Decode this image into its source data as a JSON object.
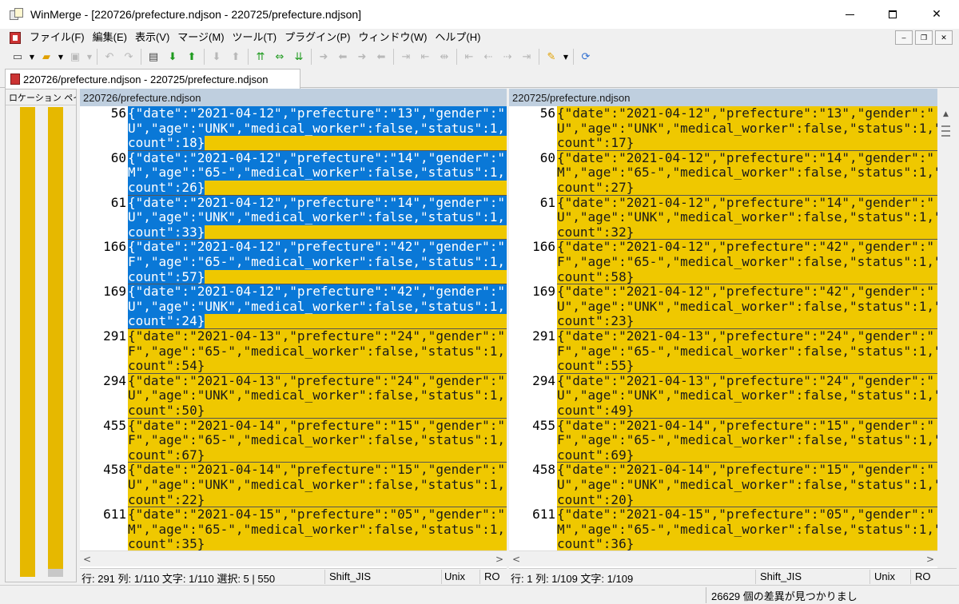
{
  "window": {
    "title": "WinMerge - [220726/prefecture.ndjson - 220725/prefecture.ndjson]",
    "minimize": "—",
    "maximize": "☐",
    "close": "✕"
  },
  "menu": {
    "items": [
      "ファイル(F)",
      "編集(E)",
      "表示(V)",
      "マージ(M)",
      "ツール(T)",
      "プラグイン(P)",
      "ウィンドウ(W)",
      "ヘルプ(H)"
    ],
    "mdi_minimize": "–",
    "mdi_restore": "❐",
    "mdi_close": "✕"
  },
  "tab": {
    "label": "220726/prefecture.ndjson - 220725/prefecture.ndjson"
  },
  "location_pane": {
    "title": "ロケーション ペイン",
    "close": "✕"
  },
  "left_pane": {
    "header": "220726/prefecture.ndjson",
    "rows": [
      {
        "num": "56",
        "l1": "{\"date\":\"2021-04-12\",\"prefecture\":\"13\",\"gender\":\"",
        "l2": "U\",\"age\":\"UNK\",\"medical_worker\":false,\"status\":1,\"",
        "l3": "count\":18}",
        "selected": true
      },
      {
        "num": "60",
        "l1": "{\"date\":\"2021-04-12\",\"prefecture\":\"14\",\"gender\":\"",
        "l2": "M\",\"age\":\"65-\",\"medical_worker\":false,\"status\":1,\"",
        "l3": "count\":26}",
        "selected": true
      },
      {
        "num": "61",
        "l1": "{\"date\":\"2021-04-12\",\"prefecture\":\"14\",\"gender\":\"",
        "l2": "U\",\"age\":\"UNK\",\"medical_worker\":false,\"status\":1,\"",
        "l3": "count\":33}",
        "selected": true
      },
      {
        "num": "166",
        "l1": "{\"date\":\"2021-04-12\",\"prefecture\":\"42\",\"gender\":\"",
        "l2": "F\",\"age\":\"65-\",\"medical_worker\":false,\"status\":1,\"",
        "l3": "count\":57}",
        "selected": true
      },
      {
        "num": "169",
        "l1": "{\"date\":\"2021-04-12\",\"prefecture\":\"42\",\"gender\":\"",
        "l2": "U\",\"age\":\"UNK\",\"medical_worker\":false,\"status\":1,\"",
        "l3": "count\":24}",
        "selected": true
      },
      {
        "num": "291",
        "l1": "{\"date\":\"2021-04-13\",\"prefecture\":\"24\",\"gender\":\"",
        "l2": "F\",\"age\":\"65-\",\"medical_worker\":false,\"status\":1,\"",
        "l3": "count\":54}",
        "selected": false
      },
      {
        "num": "294",
        "l1": "{\"date\":\"2021-04-13\",\"prefecture\":\"24\",\"gender\":\"",
        "l2": "U\",\"age\":\"UNK\",\"medical_worker\":false,\"status\":1,\"",
        "l3": "count\":50}",
        "selected": false
      },
      {
        "num": "455",
        "l1": "{\"date\":\"2021-04-14\",\"prefecture\":\"15\",\"gender\":\"",
        "l2": "F\",\"age\":\"65-\",\"medical_worker\":false,\"status\":1,\"",
        "l3": "count\":67}",
        "selected": false
      },
      {
        "num": "458",
        "l1": "{\"date\":\"2021-04-14\",\"prefecture\":\"15\",\"gender\":\"",
        "l2": "U\",\"age\":\"UNK\",\"medical_worker\":false,\"status\":1,\"",
        "l3": "count\":22}",
        "selected": false
      },
      {
        "num": "611",
        "l1": "{\"date\":\"2021-04-15\",\"prefecture\":\"05\",\"gender\":\"",
        "l2": "M\",\"age\":\"65-\",\"medical_worker\":false,\"status\":1,\"",
        "l3": "count\":35}",
        "selected": false
      }
    ],
    "status": {
      "pos": "行: 291  列: 1/110  文字: 1/110  選択: 5 | 550",
      "encoding": "Shift_JIS",
      "eol": "Unix",
      "mode": "RO"
    }
  },
  "right_pane": {
    "header": "220725/prefecture.ndjson",
    "rows": [
      {
        "num": "56",
        "l1": "{\"date\":\"2021-04-12\",\"prefecture\":\"13\",\"gender\":\"",
        "l2": "U\",\"age\":\"UNK\",\"medical_worker\":false,\"status\":1,\"",
        "l3": "count\":17}"
      },
      {
        "num": "60",
        "l1": "{\"date\":\"2021-04-12\",\"prefecture\":\"14\",\"gender\":\"",
        "l2": "M\",\"age\":\"65-\",\"medical_worker\":false,\"status\":1,\"",
        "l3": "count\":27}"
      },
      {
        "num": "61",
        "l1": "{\"date\":\"2021-04-12\",\"prefecture\":\"14\",\"gender\":\"",
        "l2": "U\",\"age\":\"UNK\",\"medical_worker\":false,\"status\":1,\"",
        "l3": "count\":32}"
      },
      {
        "num": "166",
        "l1": "{\"date\":\"2021-04-12\",\"prefecture\":\"42\",\"gender\":\"",
        "l2": "F\",\"age\":\"65-\",\"medical_worker\":false,\"status\":1,\"",
        "l3": "count\":58}"
      },
      {
        "num": "169",
        "l1": "{\"date\":\"2021-04-12\",\"prefecture\":\"42\",\"gender\":\"",
        "l2": "U\",\"age\":\"UNK\",\"medical_worker\":false,\"status\":1,\"",
        "l3": "count\":23}"
      },
      {
        "num": "291",
        "l1": "{\"date\":\"2021-04-13\",\"prefecture\":\"24\",\"gender\":\"",
        "l2": "F\",\"age\":\"65-\",\"medical_worker\":false,\"status\":1,\"",
        "l3": "count\":55}"
      },
      {
        "num": "294",
        "l1": "{\"date\":\"2021-04-13\",\"prefecture\":\"24\",\"gender\":\"",
        "l2": "U\",\"age\":\"UNK\",\"medical_worker\":false,\"status\":1,\"",
        "l3": "count\":49}"
      },
      {
        "num": "455",
        "l1": "{\"date\":\"2021-04-14\",\"prefecture\":\"15\",\"gender\":\"",
        "l2": "F\",\"age\":\"65-\",\"medical_worker\":false,\"status\":1,\"",
        "l3": "count\":69}"
      },
      {
        "num": "458",
        "l1": "{\"date\":\"2021-04-14\",\"prefecture\":\"15\",\"gender\":\"",
        "l2": "U\",\"age\":\"UNK\",\"medical_worker\":false,\"status\":1,\"",
        "l3": "count\":20}"
      },
      {
        "num": "611",
        "l1": "{\"date\":\"2021-04-15\",\"prefecture\":\"05\",\"gender\":\"",
        "l2": "M\",\"age\":\"65-\",\"medical_worker\":false,\"status\":1,\"",
        "l3": "count\":36}"
      }
    ],
    "status": {
      "pos": "行: 1  列: 1/109  文字: 1/109",
      "encoding": "Shift_JIS",
      "eol": "Unix",
      "mode": "RO"
    }
  },
  "scroll": {
    "left_arrow": "<",
    "right_arrow": ">",
    "up_arrow": "▲"
  },
  "statusbar": {
    "diff_count": "26629 個の差異が見つかりまし"
  },
  "colors": {
    "diff": "#efc800",
    "selection": "#0a78d7",
    "pane_header": "#bfcfdf",
    "location_bar": "#e6b800"
  },
  "toolbar": {
    "icons": [
      {
        "name": "new-icon",
        "glyph": "▭",
        "cls": "ic-dark"
      },
      {
        "name": "new-dropdown-icon",
        "glyph": "▼",
        "cls": "drop"
      },
      {
        "name": "open-icon",
        "glyph": "▰",
        "cls": "ic-orange"
      },
      {
        "name": "open-dropdown-icon",
        "glyph": "▼",
        "cls": "drop"
      },
      {
        "name": "save-icon",
        "glyph": "▣",
        "cls": "disabled"
      },
      {
        "name": "save-dropdown-icon",
        "glyph": "▼",
        "cls": "drop disabled"
      },
      {
        "name": "sep",
        "glyph": ""
      },
      {
        "name": "undo-icon",
        "glyph": "↶",
        "cls": "disabled"
      },
      {
        "name": "redo-icon",
        "glyph": "↷",
        "cls": "disabled"
      },
      {
        "name": "sep",
        "glyph": ""
      },
      {
        "name": "filmstrip-icon",
        "glyph": "▤",
        "cls": "ic-dark"
      },
      {
        "name": "next-diff-icon",
        "glyph": "⬇",
        "cls": "ic-green"
      },
      {
        "name": "prev-diff-icon",
        "glyph": "⬆",
        "cls": "ic-green"
      },
      {
        "name": "sep",
        "glyph": ""
      },
      {
        "name": "next-conflict-icon",
        "glyph": "⬇",
        "cls": "disabled"
      },
      {
        "name": "prev-conflict-icon",
        "glyph": "⬆",
        "cls": "disabled"
      },
      {
        "name": "sep",
        "glyph": ""
      },
      {
        "name": "first-diff-icon",
        "glyph": "⇈",
        "cls": "ic-green"
      },
      {
        "name": "current-diff-icon",
        "glyph": "⇔",
        "cls": "ic-green"
      },
      {
        "name": "last-diff-icon",
        "glyph": "⇊",
        "cls": "ic-green"
      },
      {
        "name": "sep",
        "glyph": ""
      },
      {
        "name": "copy-right-icon",
        "glyph": "➜",
        "cls": "disabled"
      },
      {
        "name": "copy-left-icon",
        "glyph": "⬅",
        "cls": "disabled"
      },
      {
        "name": "copy-right-advance-icon",
        "glyph": "➜",
        "cls": "disabled"
      },
      {
        "name": "copy-left-advance-icon",
        "glyph": "⬅",
        "cls": "disabled"
      },
      {
        "name": "sep",
        "glyph": ""
      },
      {
        "name": "copy-all-right-icon",
        "glyph": "⇥",
        "cls": "disabled"
      },
      {
        "name": "copy-all-left-icon",
        "glyph": "⇤",
        "cls": "disabled"
      },
      {
        "name": "merge-icon",
        "glyph": "⇹",
        "cls": "disabled"
      },
      {
        "name": "sep",
        "glyph": ""
      },
      {
        "name": "prev-file-icon",
        "glyph": "⇤",
        "cls": "disabled"
      },
      {
        "name": "left-icon",
        "glyph": "⇠",
        "cls": "disabled"
      },
      {
        "name": "right-icon",
        "glyph": "⇢",
        "cls": "disabled"
      },
      {
        "name": "next-file-icon",
        "glyph": "⇥",
        "cls": "disabled"
      },
      {
        "name": "sep",
        "glyph": ""
      },
      {
        "name": "options-icon",
        "glyph": "✎",
        "cls": "ic-orange"
      },
      {
        "name": "options-dropdown-icon",
        "glyph": "▼",
        "cls": "drop"
      },
      {
        "name": "sep",
        "glyph": ""
      },
      {
        "name": "refresh-icon",
        "glyph": "⟳",
        "cls": "ic-blue"
      }
    ]
  }
}
